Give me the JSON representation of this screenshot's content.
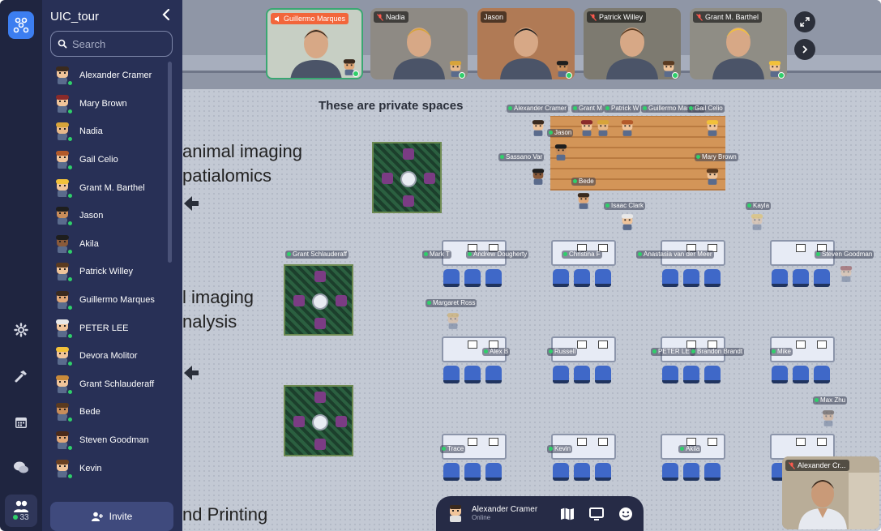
{
  "rail": {
    "people_count": "33"
  },
  "sidebar": {
    "title": "UIC_tour",
    "search_placeholder": "Search",
    "invite_label": "Invite",
    "people": [
      {
        "name": "Alexander Cramer",
        "hair": "#3a2a1e",
        "skin": "#f0c49a"
      },
      {
        "name": "Mary Brown",
        "hair": "#8a2a2a",
        "skin": "#f0c49a"
      },
      {
        "name": "Nadia",
        "hair": "#d7a43a",
        "skin": "#e8b98a"
      },
      {
        "name": "Gail Celio",
        "hair": "#b35a2a",
        "skin": "#f0c49a"
      },
      {
        "name": "Grant M. Barthel",
        "hair": "#f2c13a",
        "skin": "#f0c49a"
      },
      {
        "name": "Jason",
        "hair": "#1e1e1e",
        "skin": "#c98d5a"
      },
      {
        "name": "Akila",
        "hair": "#1e1e1e",
        "skin": "#8a5a3a"
      },
      {
        "name": "Patrick Willey",
        "hair": "#5a3a20",
        "skin": "#f0c49a"
      },
      {
        "name": "Guillermo Marques",
        "hair": "#3a2a1e",
        "skin": "#e0a878"
      },
      {
        "name": "PETER LEE",
        "hair": "#e8e8e8",
        "skin": "#f0c49a"
      },
      {
        "name": "Devora Molitor",
        "hair": "#f2c13a",
        "skin": "#f0c49a"
      },
      {
        "name": "Grant Schlauderaff",
        "hair": "#c98a3a",
        "skin": "#f0c49a"
      },
      {
        "name": "Bede",
        "hair": "#5a3a20",
        "skin": "#c98d5a"
      },
      {
        "name": "Steven Goodman",
        "hair": "#4a2a1a",
        "skin": "#e0a878"
      },
      {
        "name": "Kevin",
        "hair": "#6a4020",
        "skin": "#f0c49a"
      }
    ]
  },
  "videos": [
    {
      "name": "Guillermo Marques",
      "muted": false,
      "highlight": true,
      "bg": "#c7cfc4"
    },
    {
      "name": "Nadia",
      "muted": true,
      "highlight": false,
      "bg": "#8e8a84"
    },
    {
      "name": "Jason",
      "muted": false,
      "highlight": false,
      "bg": "#b07a55"
    },
    {
      "name": "Patrick Willey",
      "muted": true,
      "highlight": false,
      "bg": "#7d7a70"
    },
    {
      "name": "Grant M. Barthel",
      "muted": true,
      "highlight": false,
      "bg": "#8f8d85"
    }
  ],
  "map": {
    "heading": "These are private spaces",
    "left_texts": [
      "animal imaging",
      "patialomics",
      "l imaging",
      "nalysis",
      "nd Printing"
    ],
    "labels": [
      "Alexander Cramer",
      "Grant M",
      "Patrick W",
      "Guillermo Marques",
      "Gail Celio",
      "Jason",
      "Sassano Var",
      "Mary Brown",
      "Bede",
      "Isaac Clark",
      "Kayla",
      "Grant Schlauderaff",
      "Mark T",
      "Andrew Dougherty",
      "Christina F",
      "Anastasia van der Meer",
      "Steven Goodman",
      "Margaret Ross",
      "Alex B",
      "Russell",
      "PETER LEE",
      "Brandon Brandt",
      "Mike",
      "Max Zhu",
      "Trace",
      "Kevin",
      "Akila"
    ]
  },
  "selfview": {
    "name": "Alexander Cr..."
  },
  "bottombar": {
    "name": "Alexander Cramer",
    "status": "Online"
  }
}
